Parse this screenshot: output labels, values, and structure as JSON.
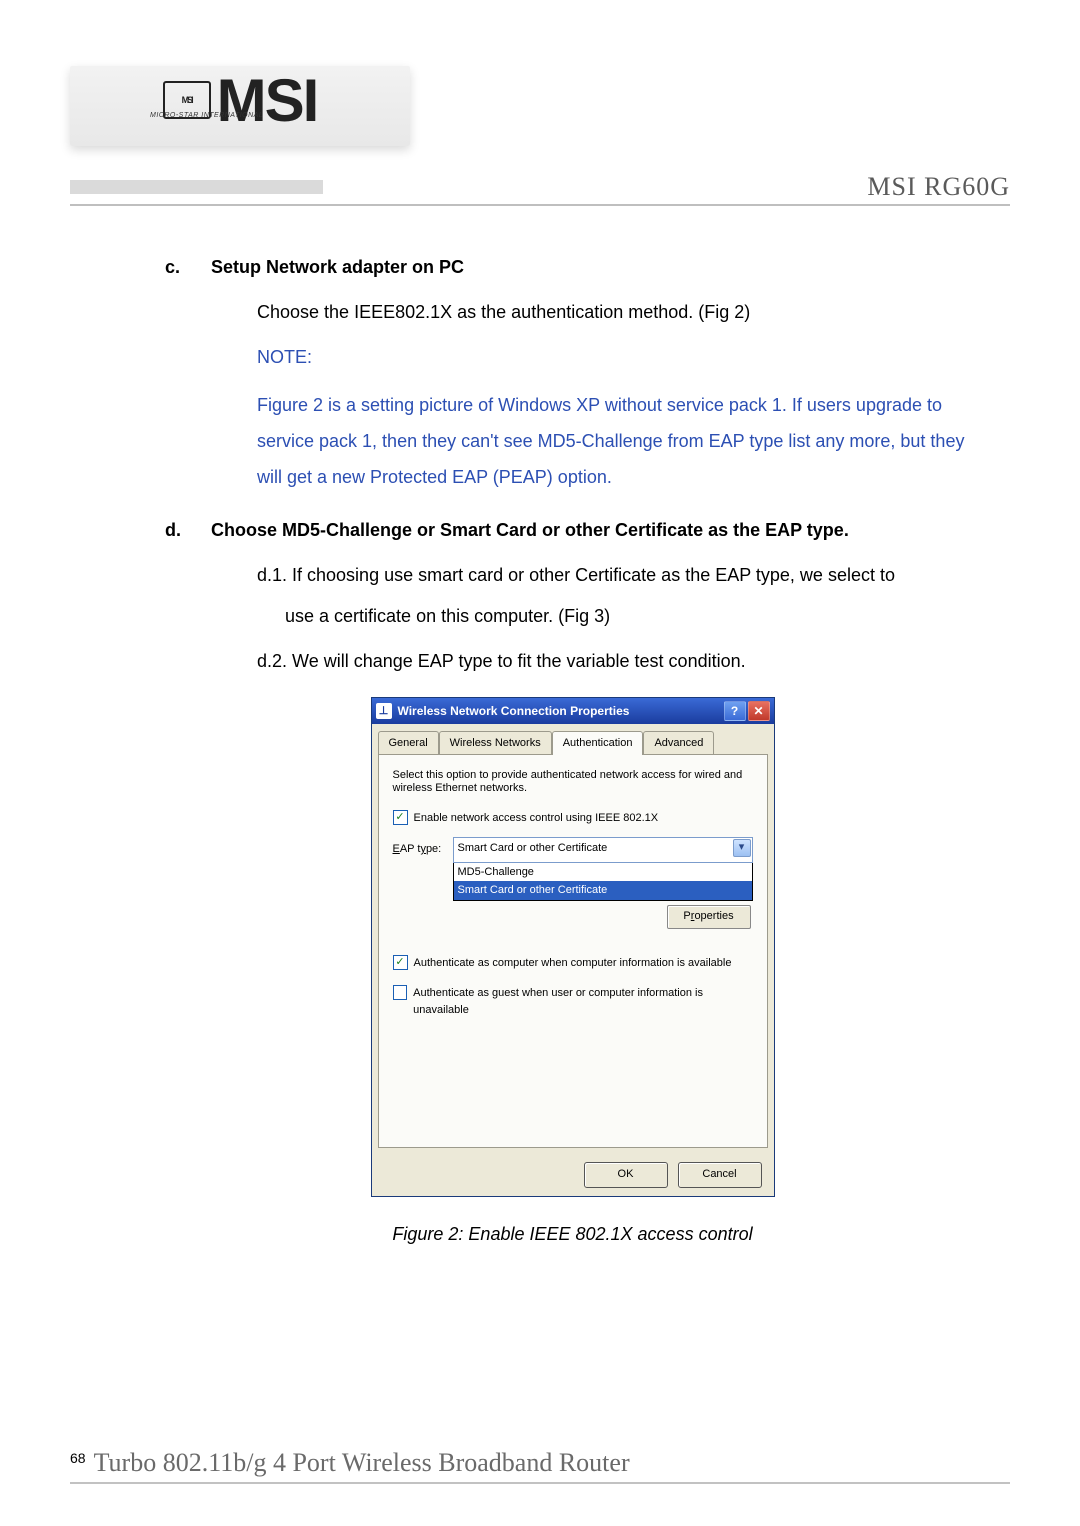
{
  "header": {
    "logo_text": "MSI",
    "logo_badge": "MSI",
    "logo_sub": "MICRO-STAR INTERNATIONAL",
    "model": "MSI RG60G"
  },
  "sections": {
    "c": {
      "letter": "c.",
      "title": "Setup Network adapter on PC",
      "para": "Choose the IEEE802.1X as the authentication method. (Fig 2)",
      "note_head": "NOTE:",
      "note_body": "Figure 2 is a setting picture of Windows XP without service pack 1. If users upgrade to service pack 1, then they can't see MD5-Challenge from EAP type list any more, but they will get a new Protected EAP (PEAP) option."
    },
    "d": {
      "letter": "d.",
      "title": "Choose MD5-Challenge or Smart Card or other Certificate as the EAP type.",
      "d1": "d.1. If choosing use smart card or other Certificate as the EAP type, we select to",
      "d1b": "use a certificate on this computer. (Fig 3)",
      "d2": "d.2. We will change EAP type to fit the variable test condition."
    }
  },
  "dialog": {
    "title": "Wireless Network Connection Properties",
    "tabs": [
      "General",
      "Wireless Networks",
      "Authentication",
      "Advanced"
    ],
    "active_tab_index": 2,
    "desc": "Select this option to provide authenticated network access for wired and wireless Ethernet networks.",
    "enable_checkbox": {
      "checked": true,
      "label": "Enable network access control using IEEE 802.1X"
    },
    "eap_label": "EAP type:",
    "eap_selected": "Smart Card or other Certificate",
    "eap_options": [
      "MD5-Challenge",
      "Smart Card or other Certificate"
    ],
    "eap_highlight_index": 1,
    "properties_btn": "Properties",
    "auth_computer": {
      "checked": true,
      "label": "Authenticate as computer when computer information is available"
    },
    "auth_guest": {
      "checked": false,
      "label": "Authenticate as guest when user or computer information is unavailable"
    },
    "ok": "OK",
    "cancel": "Cancel"
  },
  "caption": "Figure 2: Enable IEEE 802.1X access control",
  "footer": {
    "page": "68",
    "title": "Turbo 802.11b/g 4 Port Wireless Broadband Router"
  }
}
